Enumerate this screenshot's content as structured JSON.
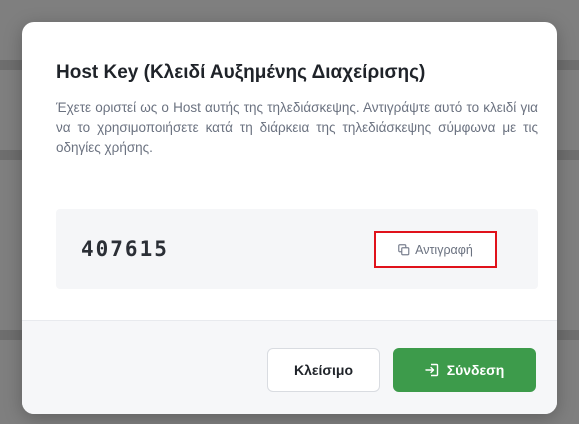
{
  "dialog": {
    "title": "Host Key (Κλειδί Αυξημένης Διαχείρισης)",
    "description": "Έχετε οριστεί ως ο Host αυτής της τηλεδιάσκεψης. Αντιγράψτε αυτό το κλειδί για να το χρησιμοποιήσετε κατά τη διάρκεια της τηλεδιάσκεψης σύμφωνα με τις οδηγίες χρήσης.",
    "host_key": "407615",
    "copy_label": "Αντιγραφή",
    "copy_icon": "copy-icon"
  },
  "footer": {
    "close_label": "Κλείσιμο",
    "connect_label": "Σύνδεση",
    "connect_icon": "login-icon"
  },
  "colors": {
    "primary_green": "#3d9b4b",
    "highlight_red": "#e0121b",
    "backdrop": "#7f7f7f"
  }
}
